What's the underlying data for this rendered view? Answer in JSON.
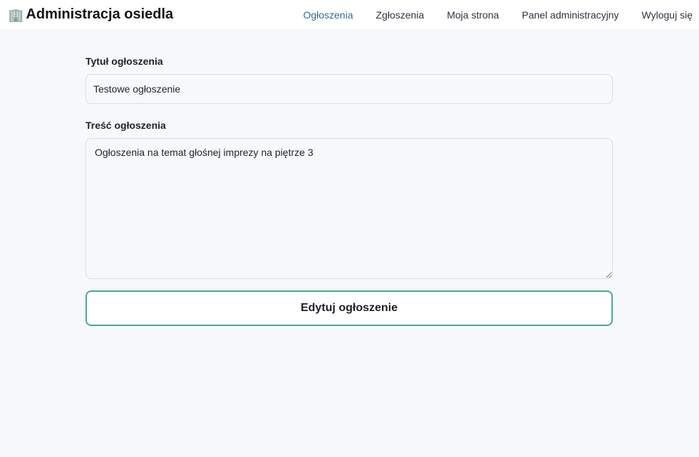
{
  "header": {
    "brand_icon": "🏢",
    "brand_title": "Administracja osiedla",
    "nav": [
      {
        "label": "Ogłoszenia",
        "active": true
      },
      {
        "label": "Zgłoszenia",
        "active": false
      },
      {
        "label": "Moja strona",
        "active": false
      },
      {
        "label": "Panel administracyjny",
        "active": false
      },
      {
        "label": "Wyloguj się",
        "active": false
      }
    ]
  },
  "form": {
    "title_label": "Tytuł ogłoszenia",
    "title_value": "Testowe ogłoszenie",
    "content_label": "Treść ogłoszenia",
    "content_value": "Ogłoszenia na temat głośnej imprezy na piętrze 3",
    "submit_label": "Edytuj ogłoszenie"
  },
  "colors": {
    "active_nav": "#2e6f86",
    "button_border": "#4aa98f",
    "page_background": "#f7f8fa"
  }
}
